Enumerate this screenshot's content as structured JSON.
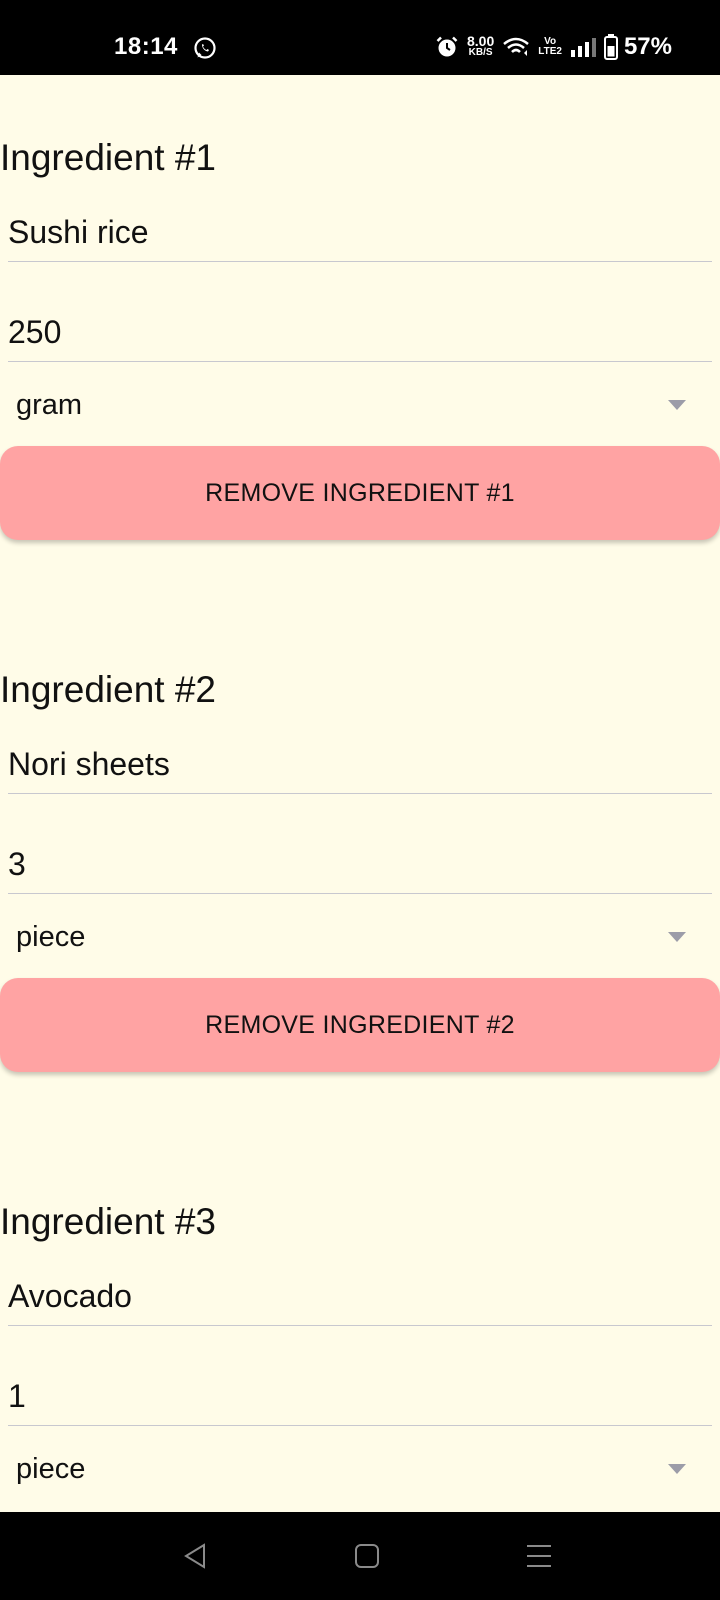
{
  "status_bar": {
    "time": "18:14",
    "net_speed_value": "8.00",
    "net_speed_unit": "KB/S",
    "volte_top": "Vo",
    "volte_bottom": "LTE2",
    "battery": "57%",
    "icons": [
      "whatsapp-icon",
      "alarm-icon",
      "wifi-icon",
      "signal-icon",
      "battery-icon"
    ]
  },
  "ingredients": [
    {
      "title": "Ingredient #1",
      "name": "Sushi rice",
      "quantity": "250",
      "unit": "gram",
      "remove_label": "REMOVE INGREDIENT #1"
    },
    {
      "title": "Ingredient #2",
      "name": "Nori sheets",
      "quantity": "3",
      "unit": "piece",
      "remove_label": "REMOVE INGREDIENT #2"
    },
    {
      "title": "Ingredient #3",
      "name": "Avocado",
      "quantity": "1",
      "unit": "piece"
    }
  ],
  "nav_bar": {
    "icons": [
      "back-icon",
      "home-icon",
      "recents-icon"
    ]
  },
  "colors": {
    "background": "#FFFCE8",
    "remove_button": "#FFA3A3",
    "underline": "#C8C8CF",
    "bars": "#000000"
  }
}
